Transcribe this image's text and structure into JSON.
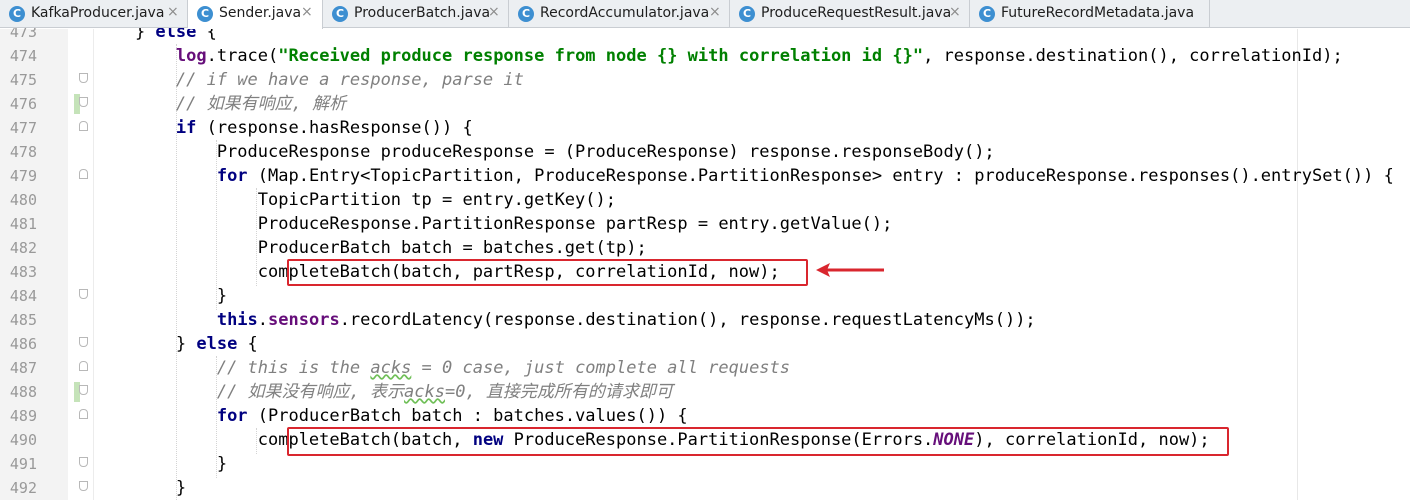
{
  "tabs": [
    {
      "label": "KafkaProducer.java",
      "icon": "C",
      "active": false
    },
    {
      "label": "Sender.java",
      "icon": "C",
      "active": true
    },
    {
      "label": "ProducerBatch.java",
      "icon": "C",
      "active": false
    },
    {
      "label": "RecordAccumulator.java",
      "icon": "C",
      "active": false
    },
    {
      "label": "ProduceRequestResult.java",
      "icon": "C",
      "active": false
    },
    {
      "label": "FutureRecordMetadata.java",
      "icon": "C",
      "active": false
    }
  ],
  "close_glyph": "×",
  "editor": {
    "lines": [
      {
        "num": "473",
        "tokens": [
          [
            "    } ",
            ""
          ],
          [
            "else",
            "kw"
          ],
          [
            " {",
            ""
          ]
        ]
      },
      {
        "num": "474",
        "tokens": [
          [
            "        ",
            ""
          ],
          [
            "log",
            "field"
          ],
          [
            ".trace(",
            ""
          ],
          [
            "\"Received produce response from node {} with correlation id {}\"",
            "str"
          ],
          [
            ", response.destination(), correlationId);",
            ""
          ]
        ]
      },
      {
        "num": "475",
        "tokens": [
          [
            "        ",
            ""
          ],
          [
            "// if we have a response, parse it",
            "cm"
          ]
        ]
      },
      {
        "num": "476",
        "tokens": [
          [
            "        ",
            ""
          ],
          [
            "// 如果有响应, 解析",
            "cm"
          ]
        ]
      },
      {
        "num": "477",
        "tokens": [
          [
            "        ",
            ""
          ],
          [
            "if",
            "kw"
          ],
          [
            " (response.hasResponse()) {",
            ""
          ]
        ]
      },
      {
        "num": "478",
        "tokens": [
          [
            "            ProduceResponse produceResponse = (ProduceResponse) response.responseBody();",
            ""
          ]
        ]
      },
      {
        "num": "479",
        "tokens": [
          [
            "            ",
            ""
          ],
          [
            "for",
            "kw"
          ],
          [
            " (Map.Entry<TopicPartition, ProduceResponse.PartitionResponse> entry : produceResponse.responses().entrySet()) {",
            ""
          ]
        ]
      },
      {
        "num": "480",
        "tokens": [
          [
            "                TopicPartition tp = entry.getKey();",
            ""
          ]
        ]
      },
      {
        "num": "481",
        "tokens": [
          [
            "                ProduceResponse.PartitionResponse partResp = entry.getValue();",
            ""
          ]
        ]
      },
      {
        "num": "482",
        "tokens": [
          [
            "                ProducerBatch batch = batches.get(tp);",
            ""
          ]
        ]
      },
      {
        "num": "483",
        "tokens": [
          [
            "                completeBatch(batch, partResp, correlationId, now);",
            ""
          ]
        ]
      },
      {
        "num": "484",
        "tokens": [
          [
            "            }",
            ""
          ]
        ]
      },
      {
        "num": "485",
        "tokens": [
          [
            "            ",
            ""
          ],
          [
            "this",
            "kw"
          ],
          [
            ".",
            ""
          ],
          [
            "sensors",
            "field"
          ],
          [
            ".recordLatency(response.destination(), response.requestLatencyMs());",
            ""
          ]
        ]
      },
      {
        "num": "486",
        "tokens": [
          [
            "        } ",
            ""
          ],
          [
            "else",
            "kw"
          ],
          [
            " {",
            ""
          ]
        ]
      },
      {
        "num": "487",
        "tokens": [
          [
            "            ",
            ""
          ],
          [
            "// this is the ",
            "cm"
          ],
          [
            "acks",
            "cmwavy"
          ],
          [
            " = 0 case, just complete all requests",
            "cm"
          ]
        ]
      },
      {
        "num": "488",
        "tokens": [
          [
            "            ",
            ""
          ],
          [
            "// 如果没有响应, 表示",
            "cm"
          ],
          [
            "acks",
            "cmwavy"
          ],
          [
            "=0, 直接完成所有的请求即可",
            "cm"
          ]
        ]
      },
      {
        "num": "489",
        "tokens": [
          [
            "            ",
            ""
          ],
          [
            "for",
            "kw"
          ],
          [
            " (ProducerBatch batch : batches.values()) {",
            ""
          ]
        ]
      },
      {
        "num": "490",
        "tokens": [
          [
            "                completeBatch(batch, ",
            ""
          ],
          [
            "new",
            "kw"
          ],
          [
            " ProduceResponse.PartitionResponse(Errors.",
            ""
          ],
          [
            "NONE",
            "cst"
          ],
          [
            "), correlationId, now);",
            ""
          ]
        ]
      },
      {
        "num": "491",
        "tokens": [
          [
            "            }",
            ""
          ]
        ]
      },
      {
        "num": "492",
        "tokens": [
          [
            "        }",
            ""
          ]
        ]
      }
    ]
  },
  "colors": {
    "annotation_red": "#d9262e",
    "keyword": "#000080",
    "string": "#008000",
    "comment": "#808080",
    "field": "#660e7a"
  }
}
